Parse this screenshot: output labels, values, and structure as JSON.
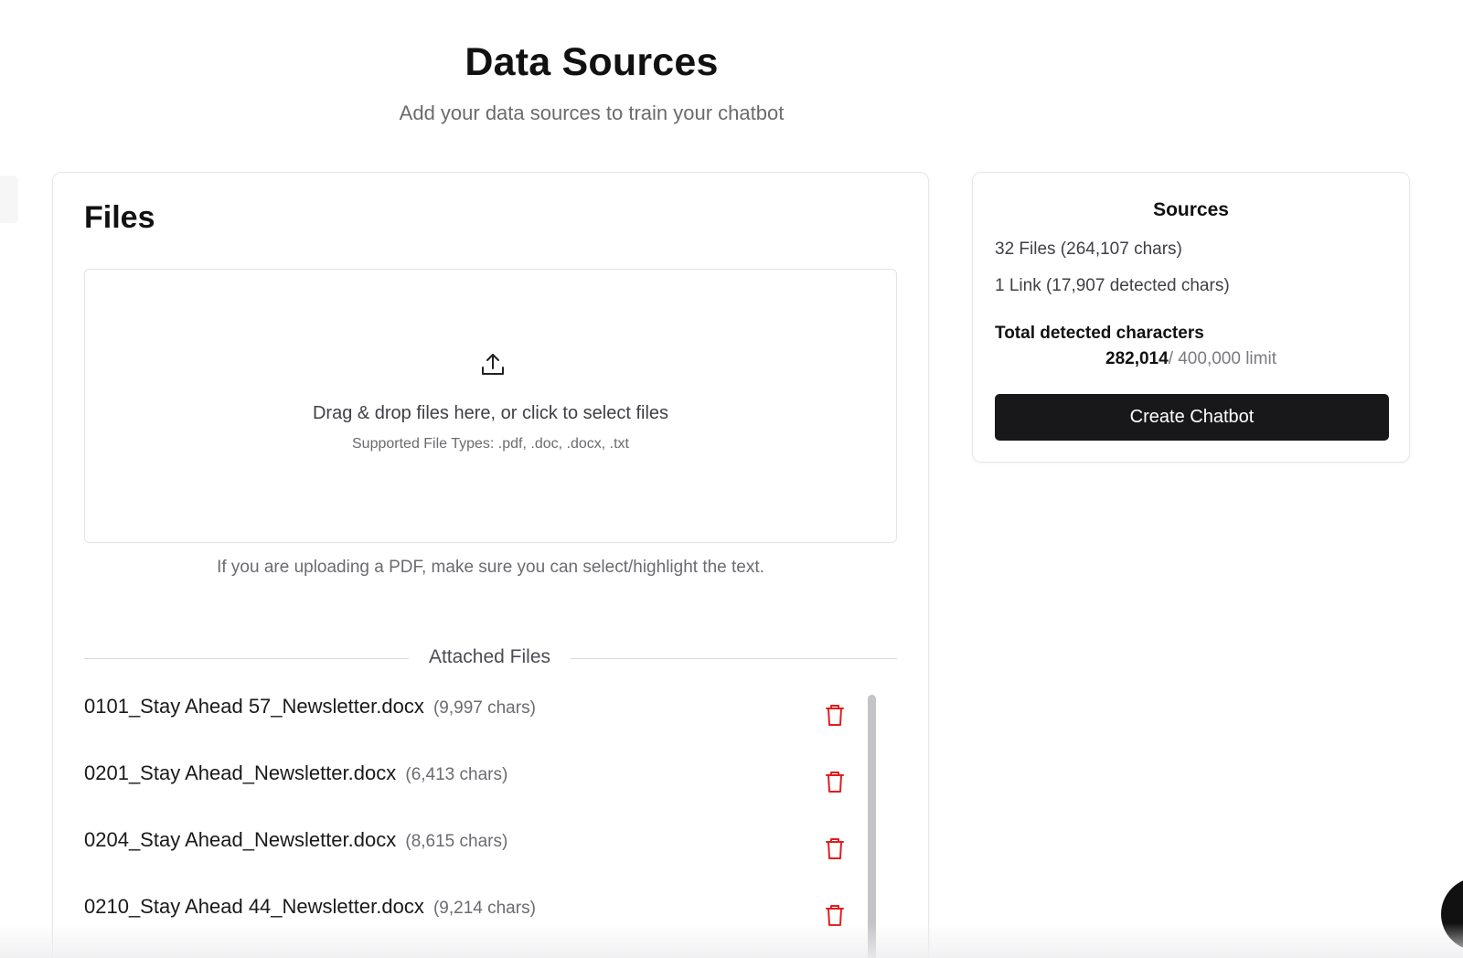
{
  "header": {
    "title": "Data Sources",
    "subtitle": "Add your data sources to train your chatbot"
  },
  "files_panel": {
    "title": "Files",
    "dropzone": {
      "icon": "upload-icon",
      "text": "Drag & drop files here, or click to select files",
      "types": "Supported File Types: .pdf, .doc, .docx, .txt"
    },
    "pdf_note": "If you are uploading a PDF, make sure you can select/highlight the text.",
    "attached_label": "Attached Files",
    "files": [
      {
        "name": "0101_Stay Ahead 57_Newsletter.docx",
        "chars": "(9,997 chars)"
      },
      {
        "name": "0201_Stay Ahead_Newsletter.docx",
        "chars": "(6,413 chars)"
      },
      {
        "name": "0204_Stay Ahead_Newsletter.docx",
        "chars": "(8,615 chars)"
      },
      {
        "name": "0210_Stay Ahead 44_Newsletter.docx",
        "chars": "(9,214 chars)"
      }
    ]
  },
  "sources_panel": {
    "title": "Sources",
    "files_summary": "32 Files (264,107 chars)",
    "link_summary": "1 Link (17,907 detected chars)",
    "total_label": "Total detected characters",
    "total_count": "282,014",
    "total_limit": "/ 400,000 limit",
    "create_button": "Create Chatbot"
  },
  "colors": {
    "accent": "#18181b",
    "delete": "#e11d1d",
    "muted_text": "#6b6b70"
  }
}
